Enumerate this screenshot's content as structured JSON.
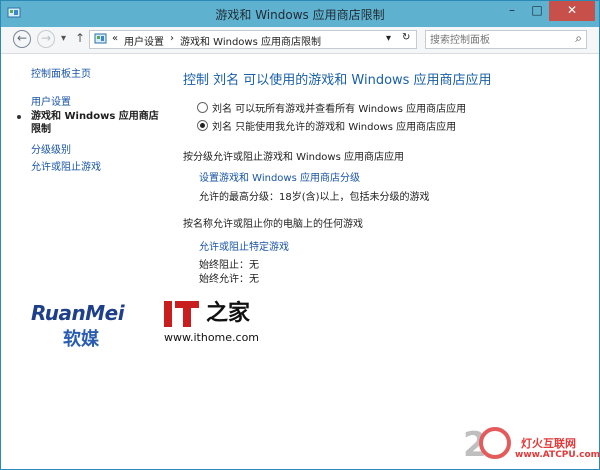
{
  "window": {
    "title": "游戏和 Windows 应用商店限制",
    "buttons": {
      "minimize": "–",
      "maximize": "□",
      "close": "✕"
    }
  },
  "navbar": {
    "back_icon": "←",
    "forward_icon": "→",
    "recent_icon": "▾",
    "up_icon": "↑",
    "address": {
      "prefix": "«",
      "crumb1": "用户设置",
      "separator": "›",
      "crumb2": "游戏和 Windows 应用商店限制",
      "dropdown_icon": "▾",
      "refresh_icon": "↻"
    },
    "search": {
      "placeholder": "搜索控制面板",
      "icon": "⌕"
    }
  },
  "sidebar": {
    "home": "控制面板主页",
    "items": [
      {
        "label": "用户设置"
      },
      {
        "label": "游戏和 Windows 应用商店限制",
        "current": true
      },
      {
        "label": "分级级别"
      },
      {
        "label": "允许或阻止游戏"
      }
    ]
  },
  "main": {
    "title": "控制 刘名 可以使用的游戏和 Windows 应用商店应用",
    "options": [
      {
        "label": "刘名 可以玩所有游戏并查看所有 Windows 应用商店应用",
        "selected": false
      },
      {
        "label": "刘名 只能使用我允许的游戏和 Windows 应用商店应用",
        "selected": true
      }
    ],
    "rating_section": {
      "heading": "按分级允许或阻止游戏和 Windows 应用商店应用",
      "link": "设置游戏和 Windows 应用商店分级",
      "info": "允许的最高分级：18岁(含)以上，包括未分级的游戏"
    },
    "name_section": {
      "heading": "按名称允许或阻止你的电脑上的任何游戏",
      "link": "允许或阻止特定游戏",
      "blocked": "始终阻止：无",
      "allowed": "始终允许：无"
    }
  },
  "watermarks": {
    "ruanmei_en": "RuanMei",
    "ruanmei_cn": "软媒",
    "ithome_zh": "之家",
    "ithome_url": "www.ithome.com",
    "atcpu_digit": "2",
    "atcpu_zh": "灯火互联网",
    "atcpu_url": "www.ATCPU.com"
  },
  "colors": {
    "titlebar": "#5fb2cf",
    "link": "#1a55a6",
    "title": "#1a5fa8",
    "close": "#c7504b"
  }
}
